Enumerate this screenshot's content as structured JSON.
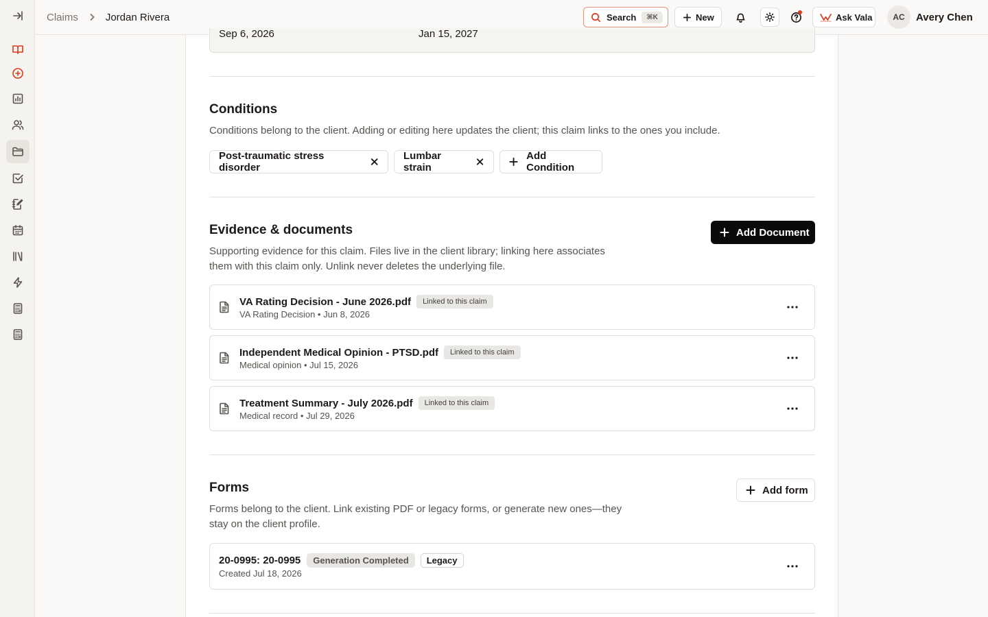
{
  "sidebar": {
    "items": [
      {
        "icon": "collapse-sidebar-icon"
      },
      {
        "icon": "book-icon"
      },
      {
        "icon": "plus-circle-icon"
      },
      {
        "icon": "bar-chart-icon"
      },
      {
        "icon": "users-icon"
      },
      {
        "icon": "folder-icon"
      },
      {
        "icon": "checkbox-icon"
      },
      {
        "icon": "notebook-edit-icon"
      },
      {
        "icon": "calendar-icon"
      },
      {
        "icon": "library-icon"
      },
      {
        "icon": "lightning-icon"
      },
      {
        "icon": "calculator-icon"
      },
      {
        "icon": "calculator-alt-icon"
      }
    ]
  },
  "header": {
    "breadcrumb": {
      "parent": "Claims",
      "current": "Jordan Rivera"
    },
    "search_label": "Search",
    "search_shortcut": "⌘K",
    "new_label": "New",
    "ask_label": "Ask Vala",
    "user": {
      "initials": "AC",
      "name": "Avery Chen"
    }
  },
  "dates": {
    "start": "Sep 6, 2026",
    "end": "Jan 15, 2027"
  },
  "conditions": {
    "title": "Conditions",
    "description": "Conditions belong to the client. Adding or editing here updates the client; this claim links to the ones you include.",
    "items": [
      "Post-traumatic stress disorder",
      "Lumbar strain"
    ],
    "add_label": "Add Condition"
  },
  "evidence": {
    "title": "Evidence & documents",
    "description_line1": "Supporting evidence for this claim. Files live in the client library; linking here associates",
    "description_line2": "them with this claim only. Unlink never deletes the underlying file.",
    "add_label": "Add Document",
    "documents": [
      {
        "name": "VA Rating Decision - June 2026.pdf",
        "badge": "Linked to this claim",
        "meta": "VA Rating Decision • Jun 8, 2026"
      },
      {
        "name": "Independent Medical Opinion - PTSD.pdf",
        "badge": "Linked to this claim",
        "meta": "Medical opinion • Jul 15, 2026"
      },
      {
        "name": "Treatment Summary - July 2026.pdf",
        "badge": "Linked to this claim",
        "meta": "Medical record • Jul 29, 2026"
      }
    ]
  },
  "forms": {
    "title": "Forms",
    "description_line1": "Forms belong to the client. Link existing PDF or legacy forms, or generate new ones—they",
    "description_line2": "stay on the client profile.",
    "add_label": "Add form",
    "items": [
      {
        "name": "20-0995: 20-0995",
        "status": "Generation Completed",
        "tag": "Legacy",
        "meta": "Created Jul 18, 2026"
      }
    ]
  }
}
